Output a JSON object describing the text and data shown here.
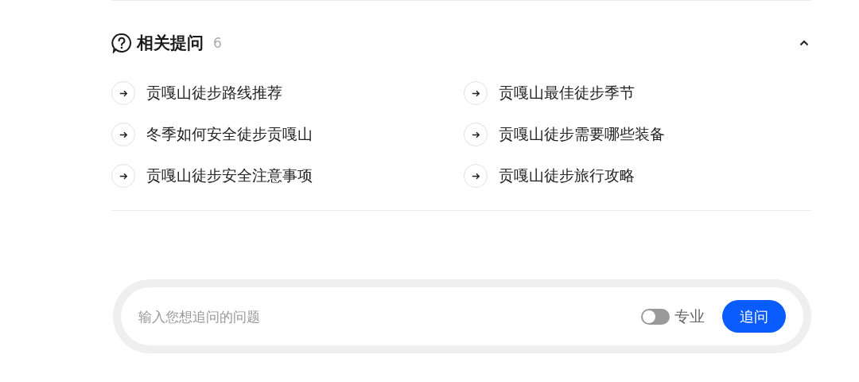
{
  "section": {
    "title": "相关提问",
    "count": "6",
    "expanded": true
  },
  "questions": [
    {
      "text": "贡嘎山徒步路线推荐"
    },
    {
      "text": "贡嘎山最佳徒步季节"
    },
    {
      "text": "冬季如何安全徒步贡嘎山"
    },
    {
      "text": "贡嘎山徒步需要哪些装备"
    },
    {
      "text": "贡嘎山徒步安全注意事项"
    },
    {
      "text": "贡嘎山徒步旅行攻略"
    }
  ],
  "composer": {
    "placeholder": "输入您想追问的问题",
    "toggle": {
      "label": "专业",
      "on": false
    },
    "submit": "追问"
  }
}
